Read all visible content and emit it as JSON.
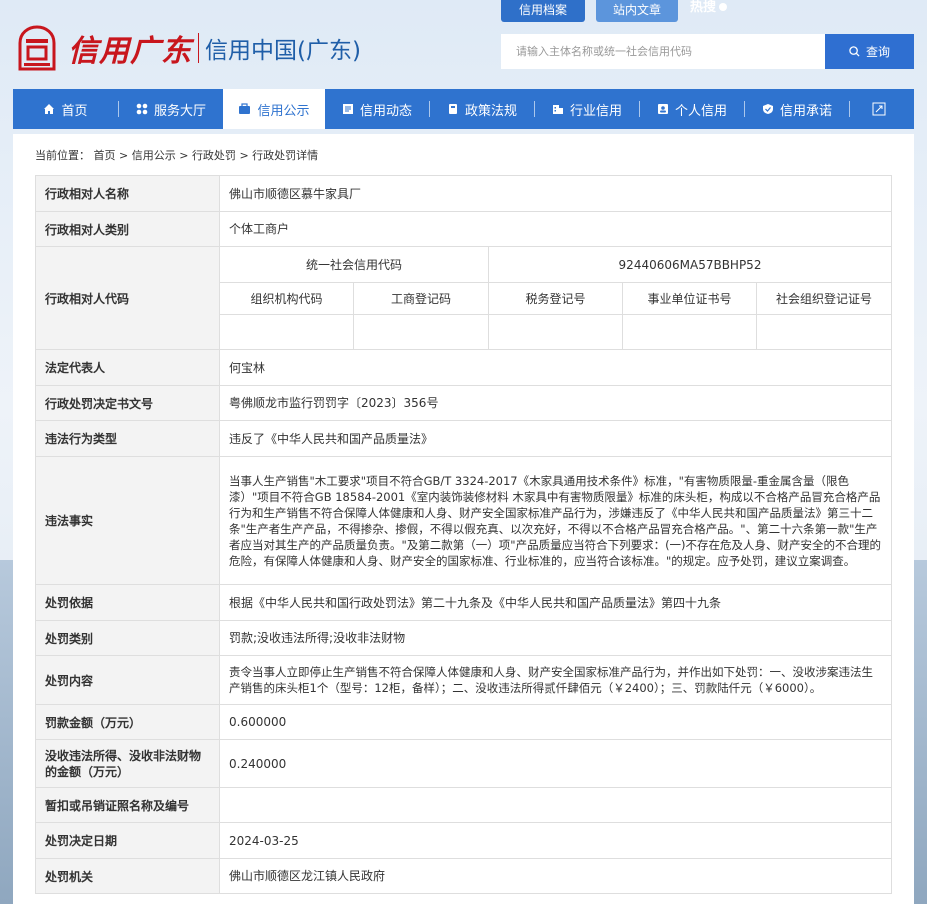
{
  "brand": {
    "logo_text": "信用广东",
    "title": "信用中国(广东)"
  },
  "top_tabs": [
    {
      "label": "信用档案"
    },
    {
      "label": "站内文章"
    }
  ],
  "hot_search": "热搜",
  "search": {
    "placeholder": "请输入主体名称或统一社会信用代码",
    "button": "查询"
  },
  "nav": [
    {
      "label": "首页",
      "icon": "home-icon"
    },
    {
      "label": "服务大厅",
      "icon": "grid-icon"
    },
    {
      "label": "信用公示",
      "icon": "briefcase-icon",
      "active": true
    },
    {
      "label": "信用动态",
      "icon": "news-icon"
    },
    {
      "label": "政策法规",
      "icon": "book-icon"
    },
    {
      "label": "行业信用",
      "icon": "building-icon"
    },
    {
      "label": "个人信用",
      "icon": "person-card-icon"
    },
    {
      "label": "信用承诺",
      "icon": "shield-check-icon"
    }
  ],
  "breadcrumb": {
    "prefix": "当前位置：",
    "items": [
      "首页",
      "信用公示",
      "行政处罚",
      "行政处罚详情"
    ],
    "separator": ">"
  },
  "record": {
    "name_label": "行政相对人名称",
    "name": "佛山市顺德区慕牛家具厂",
    "type_label": "行政相对人类别",
    "type": "个体工商户",
    "code_label": "行政相对人代码",
    "code_headers": {
      "uscc": "统一社会信用代码",
      "uscc_value": "92440606MA57BBHP52",
      "org": "组织机构代码",
      "biz": "工商登记码",
      "tax": "税务登记号",
      "inst": "事业单位证书号",
      "social": "社会组织登记证号"
    },
    "legal_rep_label": "法定代表人",
    "legal_rep": "何宝林",
    "doc_no_label": "行政处罚决定书文号",
    "doc_no": "粤佛顺龙市监行罚罚字〔2023〕356号",
    "violation_type_label": "违法行为类型",
    "violation_type": "违反了《中华人民共和国产品质量法》",
    "facts_label": "违法事实",
    "facts": "当事人生产销售\"木工要求\"项目不符合GB/T 3324-2017《木家具通用技术条件》标准，\"有害物质限量-重金属含量（限色漆）\"项目不符合GB 18584-2001《室内装饰装修材料 木家具中有害物质限量》标准的床头柜，构成以不合格产品冒充合格产品行为和生产销售不符合保障人体健康和人身、财产安全国家标准产品行为，涉嫌违反了《中华人民共和国产品质量法》第三十二条\"生产者生产产品，不得掺杂、掺假，不得以假充真、以次充好，不得以不合格产品冒充合格产品。\"、第二十六条第一款\"生产者应当对其生产的产品质量负责。\"及第二款第（一）项\"产品质量应当符合下列要求：(一)不存在危及人身、财产安全的不合理的危险，有保障人体健康和人身、财产安全的国家标准、行业标准的，应当符合该标准。\"的规定。应予处罚，建议立案调查。",
    "basis_label": "处罚依据",
    "basis": "根据《中华人民共和国行政处罚法》第二十九条及《中华人民共和国产品质量法》第四十九条",
    "category_label": "处罚类别",
    "category": "罚款;没收违法所得;没收非法财物",
    "content_label": "处罚内容",
    "content": "责令当事人立即停止生产销售不符合保障人体健康和人身、财产安全国家标准产品行为，并作出如下处罚：一、没收涉案违法生产销售的床头柜1个（型号：12柜，备样）；二、没收违法所得贰仟肆佰元（￥2400）；三、罚款陆仟元（￥6000）。",
    "fine_label": "罚款金额（万元）",
    "fine": "0.600000",
    "confiscated_label": "没收违法所得、没收非法财物的金额（万元）",
    "confiscated": "0.240000",
    "license_label": "暂扣或吊销证照名称及编号",
    "license": "",
    "date_label": "处罚决定日期",
    "date": "2024-03-25",
    "authority_label": "处罚机关",
    "authority": "佛山市顺德区龙江镇人民政府"
  },
  "colors": {
    "nav_bg": "#2f73cf",
    "brand_red": "#c8161d",
    "brand_blue": "#1f5ea8",
    "search_button": "#2f6fd1"
  }
}
